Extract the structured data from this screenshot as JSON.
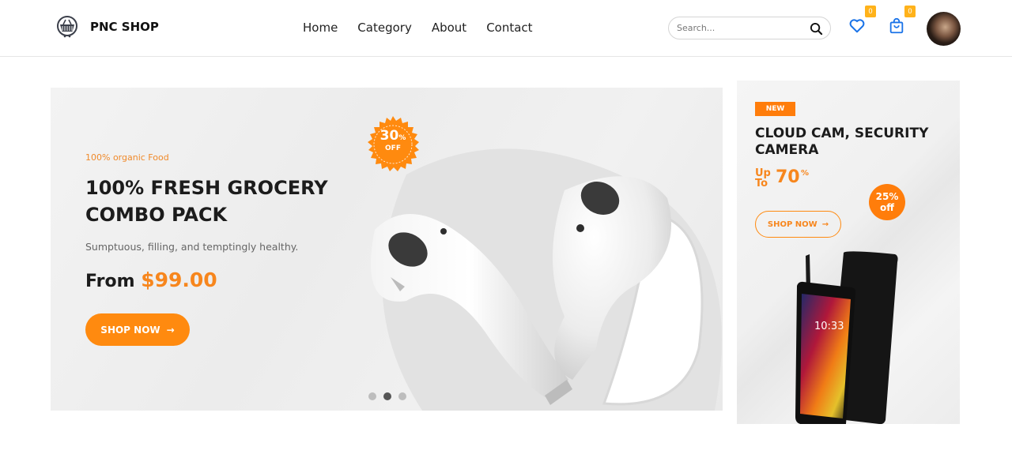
{
  "brand": {
    "name": "PNC SHOP",
    "logo_icon": "basket-logo-icon"
  },
  "nav": {
    "items": [
      "Home",
      "Category",
      "About",
      "Contact"
    ]
  },
  "search": {
    "placeholder": "Search...",
    "icon": "search-icon"
  },
  "wishlist": {
    "icon": "heart-icon",
    "count": "0"
  },
  "cart": {
    "icon": "shopping-bag-icon",
    "count": "0"
  },
  "colors": {
    "accent": "#ff8a0f",
    "badge": "#ffb21a",
    "text": "#1c1c1c"
  },
  "hero": {
    "subtitle": "100% organic Food",
    "title": "100% FRESH GROCERY COMBO PACK",
    "description": "Sumptuous, filling, and temptingly healthy.",
    "price_prefix": "From",
    "price": "$99.00",
    "button_label": "SHOP NOW",
    "discount": {
      "value": "30",
      "unit": "%",
      "label": "OFF"
    },
    "slides": {
      "count": 3,
      "active_index": 1
    }
  },
  "promo": {
    "badge": "NEW",
    "title": "CLOUD CAM, SECURITY CAMERA",
    "up_to_label": "Up To",
    "up_to_value": "70",
    "up_to_unit": "%",
    "discount_line1": "25%",
    "discount_line2": "off",
    "button_label": "SHOP NOW"
  }
}
